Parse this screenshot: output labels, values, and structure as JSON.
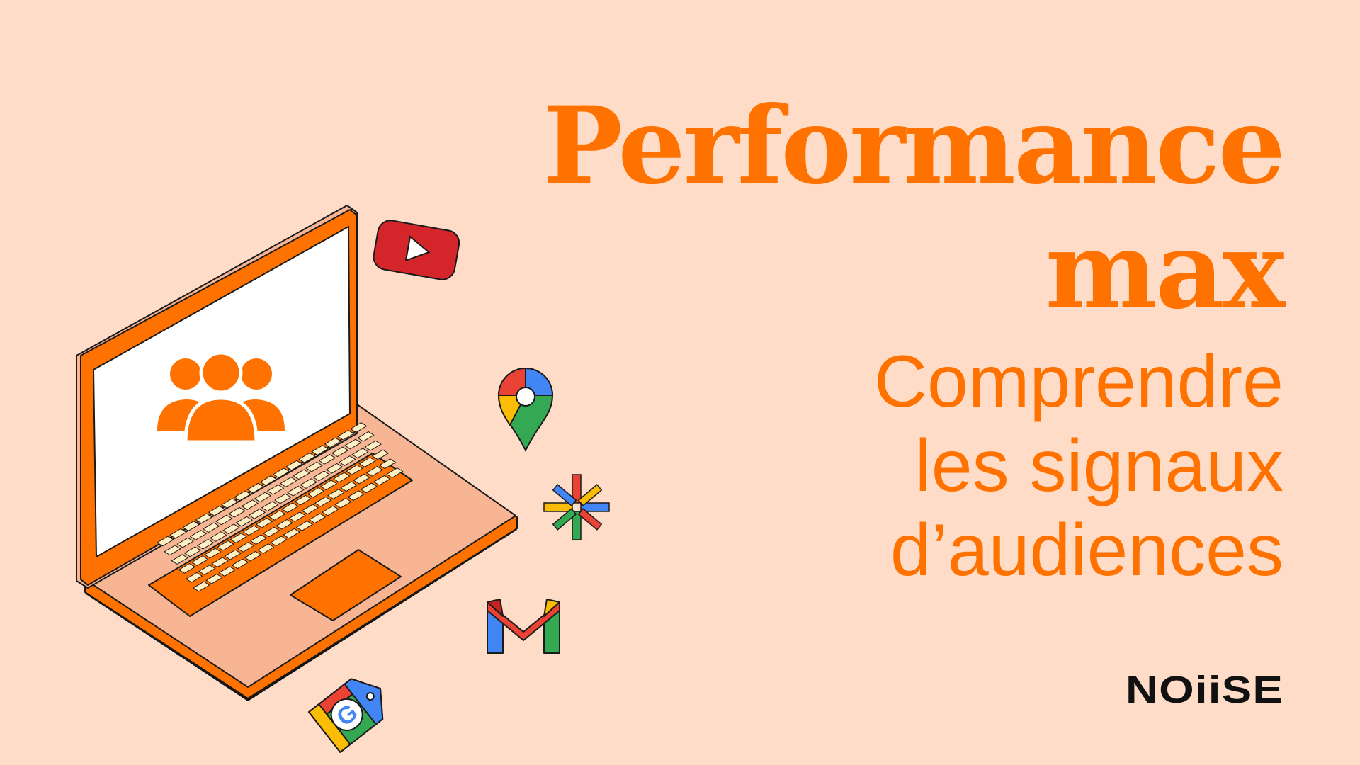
{
  "title": {
    "line1": "Performance",
    "line2": "max"
  },
  "subtitle": {
    "line1": "Comprendre",
    "line2": "les signaux",
    "line3": "d’audiences"
  },
  "brand": "NOiiSE",
  "icons": [
    "laptop-icon",
    "users-icon",
    "youtube-icon",
    "maps-pin-icon",
    "google-asterisk-icon",
    "gmail-icon",
    "google-shopping-tag-icon"
  ],
  "colors": {
    "background": "#fedcc8",
    "accent": "#ff7200",
    "brand": "#111111",
    "laptop_base": "#f7b594",
    "keys": "#fff0c4",
    "youtube_red": "#d4262a",
    "google_blue": "#4285f4",
    "google_red": "#ea4335",
    "google_yellow": "#fbbc04",
    "google_green": "#34a853"
  }
}
